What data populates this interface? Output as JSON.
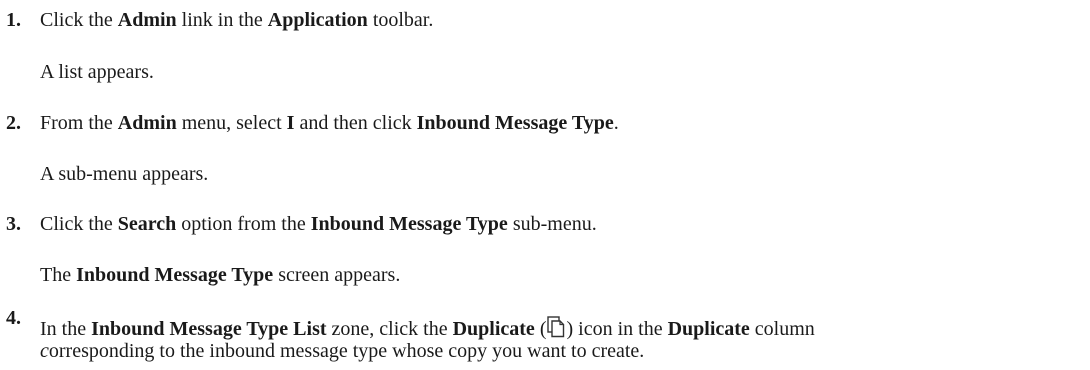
{
  "steps": [
    {
      "number": "1.",
      "parts": [
        "Click the ",
        "Admin",
        " link in the ",
        "Application",
        " toolbar."
      ],
      "result": "A list appears."
    },
    {
      "number": "2.",
      "parts": [
        "From the ",
        "Admin",
        " menu, select ",
        "I",
        " and then click ",
        "Inbound Message Type",
        "."
      ],
      "result": "A sub-menu appears."
    },
    {
      "number": "3.",
      "parts": [
        "Click the ",
        "Search",
        " option from the ",
        "Inbound Message Type",
        " sub-menu."
      ],
      "result_parts": [
        "The ",
        "Inbound Message Type",
        " screen appears."
      ]
    },
    {
      "number": "4.",
      "parts": [
        "In the ",
        "Inbound Message Type List",
        " zone, click the ",
        "Duplicate",
        " (",
        ") icon in the ",
        "Duplicate",
        " column"
      ],
      "continuation": [
        "c",
        "orresponding to the inbound message type whose copy you want to create."
      ],
      "icon": "duplicate-icon"
    }
  ]
}
